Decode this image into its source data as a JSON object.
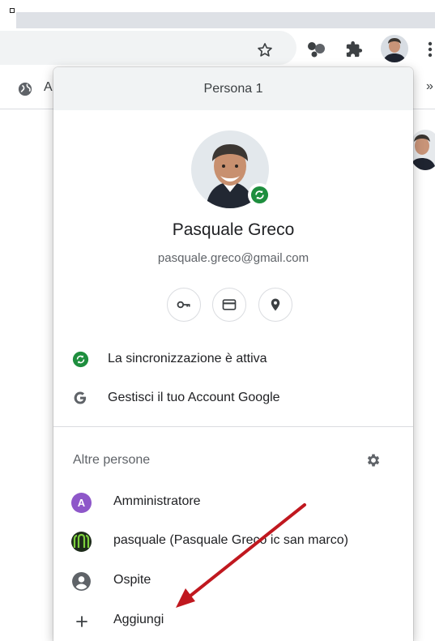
{
  "toolbar": {
    "star_icon": "star-outline-icon",
    "extension_icons": [
      "extension-icon",
      "puzzle-piece-icon"
    ],
    "menu_icon": "more-vert-icon"
  },
  "bookmarks": {
    "first_label": "A",
    "more": "»"
  },
  "profile_menu": {
    "header": "Persona 1",
    "name": "Pasquale Greco",
    "email": "pasquale.greco@gmail.com",
    "quick_actions": [
      "key-icon",
      "credit-card-icon",
      "location-pin-icon"
    ],
    "sync_label": "La sincronizzazione è attiva",
    "manage_account_label": "Gestisci il tuo Account Google",
    "other_people_label": "Altre persone",
    "people": [
      {
        "name": "Amministratore",
        "initial": "A",
        "avatar_color": "#8e57c9"
      },
      {
        "name": "pasquale (Pasquale Greco ic san marco)"
      },
      {
        "name": "Ospite"
      }
    ],
    "add_label": "Aggiungi"
  },
  "colors": {
    "sync_green": "#1e8e3e",
    "header_bg": "#f1f3f4",
    "annotation_arrow": "#c0181f"
  }
}
